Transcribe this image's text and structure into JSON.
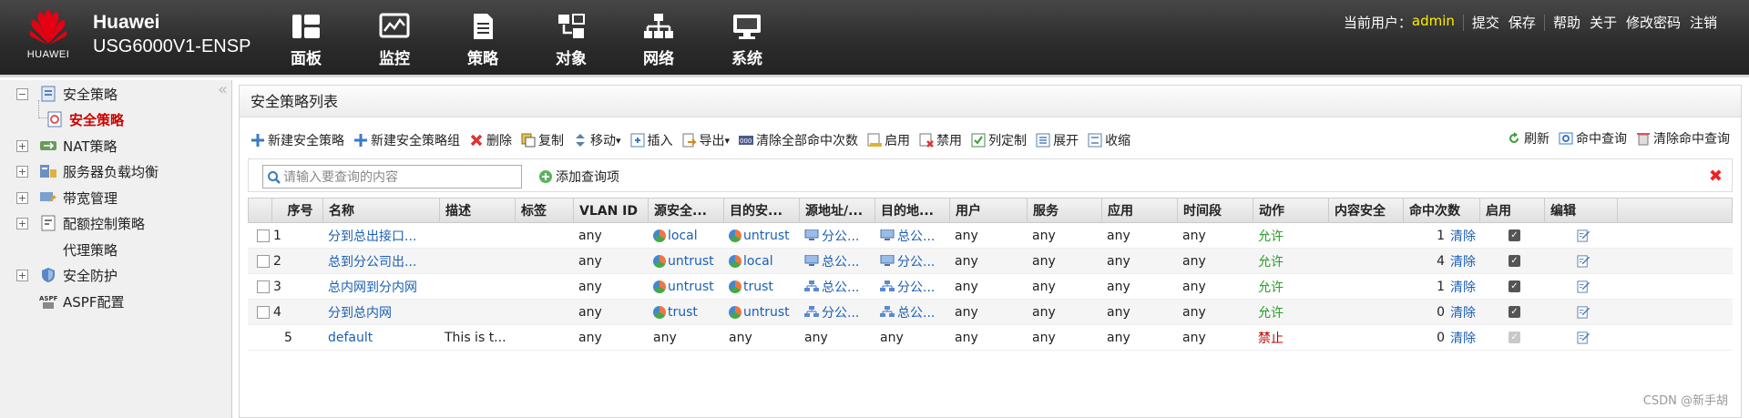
{
  "brand": {
    "logo_text": "HUAWEI",
    "line1": "Huawei",
    "line2": "USG6000V1-ENSP"
  },
  "nav": [
    {
      "label": "面板",
      "icon": "dashboard-icon"
    },
    {
      "label": "监控",
      "icon": "monitor-icon"
    },
    {
      "label": "策略",
      "icon": "policy-icon"
    },
    {
      "label": "对象",
      "icon": "object-icon"
    },
    {
      "label": "网络",
      "icon": "network-icon"
    },
    {
      "label": "系统",
      "icon": "system-icon"
    }
  ],
  "userbar": {
    "current_user_label": "当前用户：",
    "username": "admin",
    "submit": "提交",
    "save": "保存",
    "help": "帮助",
    "about": "关于",
    "change_password": "修改密码",
    "logout": "注销"
  },
  "sidebar": {
    "collapse": "«",
    "items": [
      {
        "label": "安全策略",
        "toggle": "−",
        "icon": "security-policy-icon"
      },
      {
        "label": "安全策略",
        "icon": "policy-page-icon",
        "selected": true
      },
      {
        "label": "NAT策略",
        "toggle": "+",
        "icon": "nat-icon"
      },
      {
        "label": "服务器负载均衡",
        "toggle": "+",
        "icon": "load-balance-icon"
      },
      {
        "label": "带宽管理",
        "toggle": "+",
        "icon": "bandwidth-icon"
      },
      {
        "label": "配额控制策略",
        "toggle": "+",
        "icon": "quota-icon"
      },
      {
        "label": "代理策略",
        "icon": "proxy-icon"
      },
      {
        "label": "安全防护",
        "toggle": "+",
        "icon": "shield-icon"
      },
      {
        "label": "ASPF配置",
        "icon": "aspf-icon",
        "icon_text": "ASPF"
      }
    ]
  },
  "panel": {
    "title": "安全策略列表"
  },
  "toolbar": {
    "left": [
      {
        "label": "新建安全策略",
        "icon": "add-icon"
      },
      {
        "label": "新建安全策略组",
        "icon": "add-group-icon"
      },
      {
        "label": "删除",
        "icon": "delete-icon"
      },
      {
        "label": "复制",
        "icon": "copy-icon"
      },
      {
        "label": "移动",
        "icon": "move-icon",
        "dropdown": "▾"
      },
      {
        "label": "插入",
        "icon": "insert-icon"
      },
      {
        "label": "导出",
        "icon": "export-icon",
        "dropdown": "▾"
      },
      {
        "label": "清除全部命中次数",
        "icon": "clear-hits-icon"
      },
      {
        "label": "启用",
        "icon": "enable-icon"
      },
      {
        "label": "禁用",
        "icon": "disable-icon"
      },
      {
        "label": "列定制",
        "icon": "columns-icon"
      },
      {
        "label": "展开",
        "icon": "expand-icon"
      },
      {
        "label": "收缩",
        "icon": "collapse-icon"
      }
    ],
    "right": [
      {
        "label": "刷新",
        "icon": "refresh-icon"
      },
      {
        "label": "命中查询",
        "icon": "hit-query-icon"
      },
      {
        "label": "清除命中查询",
        "icon": "clear-query-icon"
      }
    ]
  },
  "search": {
    "placeholder": "请输入要查询的内容",
    "add_query": "添加查询项",
    "close": "✖"
  },
  "table": {
    "columns": [
      "序号",
      "名称",
      "描述",
      "标签",
      "VLAN ID",
      "源安全...",
      "目的安...",
      "源地址/...",
      "目的地...",
      "用户",
      "服务",
      "应用",
      "时间段",
      "动作",
      "内容安全",
      "命中次数",
      "启用",
      "编辑"
    ],
    "rows": [
      {
        "no": "1",
        "name": "分到总出接口...",
        "desc": "",
        "tag": "",
        "vlan": "any",
        "src_zone": "local",
        "dst_zone": "untrust",
        "src_addr": "分公...",
        "dst_addr": "总公...",
        "user": "any",
        "service": "any",
        "app": "any",
        "time": "any",
        "action": "允许",
        "content": "",
        "hits": "1",
        "clear": "清除",
        "enabled": true
      },
      {
        "no": "2",
        "name": "总到分公司出...",
        "desc": "",
        "tag": "",
        "vlan": "any",
        "src_zone": "untrust",
        "dst_zone": "local",
        "src_addr": "总公...",
        "dst_addr": "分公...",
        "user": "any",
        "service": "any",
        "app": "any",
        "time": "any",
        "action": "允许",
        "content": "",
        "hits": "4",
        "clear": "清除",
        "enabled": true
      },
      {
        "no": "3",
        "name": "总内网到分内网",
        "desc": "",
        "tag": "",
        "vlan": "any",
        "src_zone": "untrust",
        "dst_zone": "trust",
        "src_addr": "总公...",
        "dst_addr": "分公...",
        "user": "any",
        "service": "any",
        "app": "any",
        "time": "any",
        "action": "允许",
        "content": "",
        "hits": "1",
        "clear": "清除",
        "enabled": true
      },
      {
        "no": "4",
        "name": "分到总内网",
        "desc": "",
        "tag": "",
        "vlan": "any",
        "src_zone": "trust",
        "dst_zone": "untrust",
        "src_addr": "分公...",
        "dst_addr": "总公...",
        "user": "any",
        "service": "any",
        "app": "any",
        "time": "any",
        "action": "允许",
        "content": "",
        "hits": "0",
        "clear": "清除",
        "enabled": true
      },
      {
        "no": "5",
        "name": "default",
        "desc": "This is t...",
        "tag": "",
        "vlan": "any",
        "src_zone": "any",
        "dst_zone": "any",
        "src_addr": "any",
        "dst_addr": "any",
        "user": "any",
        "service": "any",
        "app": "any",
        "time": "any",
        "action": "禁止",
        "content": "",
        "hits": "0",
        "clear": "清除",
        "enabled": true
      }
    ]
  },
  "watermark": "CSDN @新手胡",
  "colors": {
    "allow": "#2a9d2a",
    "deny": "#b00000",
    "link": "#1a5fb4",
    "username": "#ffee00"
  }
}
